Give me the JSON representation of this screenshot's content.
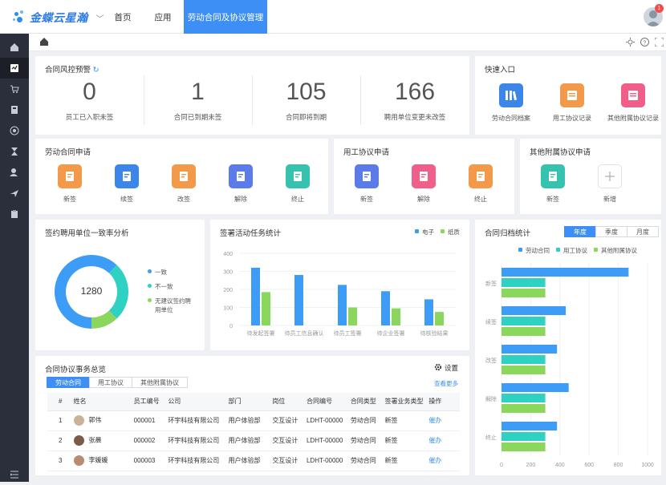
{
  "header": {
    "logo_text": "金蝶云星瀚",
    "nav": [
      "首页",
      "应用",
      "劳动合同及协议管理"
    ],
    "notification_count": "1"
  },
  "risk": {
    "title": "合同风控预警",
    "metrics": [
      {
        "value": "0",
        "label": "员工已入职未签"
      },
      {
        "value": "1",
        "label": "合同已到期未签"
      },
      {
        "value": "105",
        "label": "合同即将到期"
      },
      {
        "value": "166",
        "label": "聘用单位变更未改签"
      }
    ]
  },
  "quick": {
    "title": "快速入口",
    "items": [
      {
        "label": "劳动合同档案",
        "color": "#3b86e8"
      },
      {
        "label": "用工协议记录",
        "color": "#f2994a"
      },
      {
        "label": "其他附属协议记录",
        "color": "#ef5f8a"
      }
    ]
  },
  "labor_apply": {
    "title": "劳动合同申请",
    "items": [
      {
        "label": "新签",
        "color": "#f2994a"
      },
      {
        "label": "续签",
        "color": "#3b86e8"
      },
      {
        "label": "改签",
        "color": "#f2994a"
      },
      {
        "label": "解除",
        "color": "#5b7be8"
      },
      {
        "label": "终止",
        "color": "#35c3b0"
      }
    ]
  },
  "work_apply": {
    "title": "用工协议申请",
    "items": [
      {
        "label": "新签",
        "color": "#5b7be8"
      },
      {
        "label": "解除",
        "color": "#ef5f8a"
      },
      {
        "label": "终止",
        "color": "#f2994a"
      }
    ]
  },
  "other_apply": {
    "title": "其他附属协议申请",
    "items": [
      {
        "label": "新签",
        "color": "#35c3b0"
      },
      {
        "label": "新增",
        "color": ""
      }
    ]
  },
  "consistency": {
    "title": "签约聘用单位一致率分析",
    "total": "1280",
    "legend": [
      {
        "label": "一致",
        "color": "#3d9cf5"
      },
      {
        "label": "不一致",
        "color": "#2fd1c3"
      },
      {
        "label": "无建议签约聘用单位",
        "color": "#8bd65d"
      }
    ]
  },
  "sign_stats": {
    "title": "签署活动任务统计",
    "legend": [
      {
        "label": "电子",
        "color": "#3d9cf5"
      },
      {
        "label": "纸质",
        "color": "#8bd65d"
      }
    ]
  },
  "archive": {
    "title": "合同归档统计",
    "tabs": [
      "年度",
      "季度",
      "月度"
    ],
    "legend": [
      {
        "label": "劳动合同",
        "color": "#3d9cf5"
      },
      {
        "label": "用工协议",
        "color": "#2fd1c3"
      },
      {
        "label": "其他附属协议",
        "color": "#8bd65d"
      }
    ]
  },
  "overview": {
    "title": "合同协议事务总览",
    "settings_label": "设置",
    "view_more": "查看更多",
    "tabs": [
      "劳动合同",
      "用工协议",
      "其他附属协议"
    ],
    "columns": [
      "#",
      "姓名",
      "员工编号",
      "公司",
      "部门",
      "岗位",
      "合同编号",
      "合同类型",
      "签署业务类型",
      "操作"
    ],
    "rows": [
      {
        "no": "1",
        "name": "郭伟",
        "emp": "000001",
        "company": "环宇科技有限公司",
        "dept": "用户体验部",
        "post": "交互设计",
        "code": "LDHT-00000",
        "type": "劳动合同",
        "biz": "新签",
        "op": "催办"
      },
      {
        "no": "2",
        "name": "张晨",
        "emp": "000002",
        "company": "环宇科技有限公司",
        "dept": "用户体验部",
        "post": "交互设计",
        "code": "LDHT-00000",
        "type": "劳动合同",
        "biz": "新签",
        "op": "催办"
      },
      {
        "no": "3",
        "name": "李媛媛",
        "emp": "000003",
        "company": "环宇科技有限公司",
        "dept": "用户体验部",
        "post": "交互设计",
        "code": "LDHT-00000",
        "type": "劳动合同",
        "biz": "新签",
        "op": "催办"
      }
    ]
  },
  "chart_data": [
    {
      "type": "pie",
      "title": "签约聘用单位一致率分析",
      "center_label": "1280",
      "categories": [
        "一致",
        "不一致",
        "无建议签约聘用单位"
      ],
      "values": [
        62,
        26,
        12
      ]
    },
    {
      "type": "bar",
      "title": "签署活动任务统计",
      "categories": [
        "待发起签署",
        "待员工信息确认",
        "待员工签署",
        "待企业签署",
        "待核验结果"
      ],
      "series": [
        {
          "name": "电子",
          "values": [
            320,
            280,
            225,
            190,
            145
          ]
        },
        {
          "name": "纸质",
          "values": [
            185,
            0,
            100,
            95,
            75
          ]
        }
      ],
      "ylim": [
        0,
        400
      ],
      "yticks": [
        0,
        100,
        200,
        300,
        400
      ],
      "legend": "top-right"
    },
    {
      "type": "bar",
      "orientation": "horizontal",
      "title": "合同归档统计",
      "categories": [
        "新签",
        "续签",
        "改签",
        "解除",
        "终止"
      ],
      "series": [
        {
          "name": "劳动合同",
          "values": [
            870,
            440,
            380,
            460,
            380
          ]
        },
        {
          "name": "用工协议",
          "values": [
            300,
            300,
            300,
            300,
            300
          ]
        },
        {
          "name": "其他附属协议",
          "values": [
            300,
            300,
            300,
            300,
            300
          ]
        }
      ],
      "xlim": [
        0,
        1000
      ],
      "xticks": [
        0,
        200,
        400,
        600,
        800,
        1000
      ],
      "legend": "top"
    }
  ]
}
